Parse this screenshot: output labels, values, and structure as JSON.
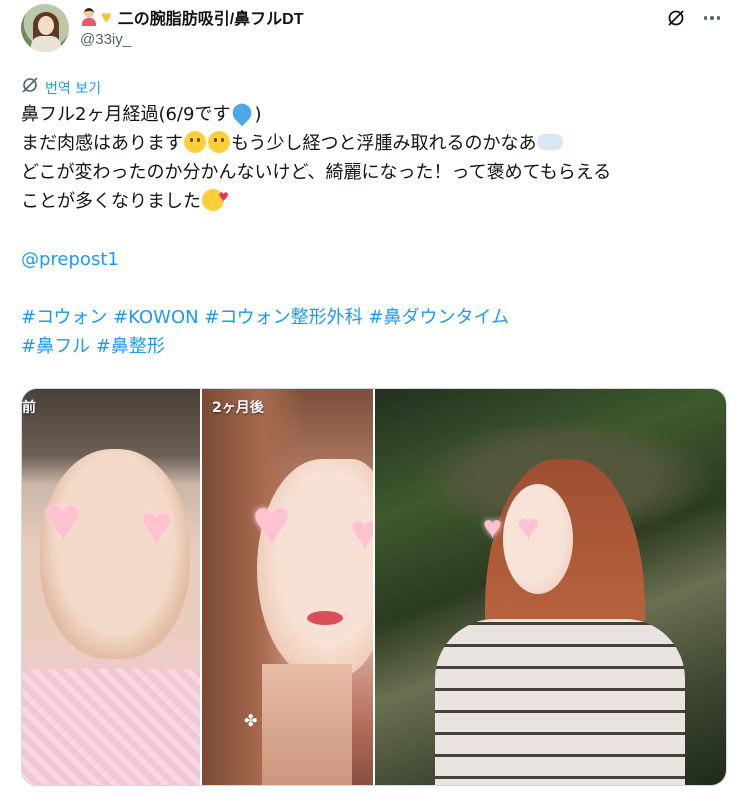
{
  "author": {
    "display_name": "二の腕脂肪吸引/鼻フルDT",
    "handle": "@33iy_",
    "name_emojis": [
      "person-emoji",
      "yellow-heart-emoji"
    ]
  },
  "actions": {
    "grok_icon": "grok-slash-icon",
    "more_icon": "more-dots-icon"
  },
  "translate": {
    "label": "번역 보기",
    "icon": "translate-globe-icon"
  },
  "tweet": {
    "line1": "鼻フル2ヶ月経過(6/9です",
    "line1_end": ")",
    "line2_a": "まだ肉感はあります",
    "line2_b": "もう少し経つと浮腫み取れるのかなあ",
    "line3": "どこが変わったのか分かんないけど、綺麗になった！って褒めてもらえる",
    "line4": "ことが多くなりました",
    "mention": "@prepost1",
    "hashtags_line1": "#コウォン #KOWON #コウォン整形外科 #鼻ダウンタイム",
    "hashtags_line2": "#鼻フル #鼻整形"
  },
  "media": {
    "panel1_label": "前",
    "panel2_label": "2ヶ月後"
  },
  "colors": {
    "accent": "#1d9bf0",
    "text": "#0f1419",
    "muted": "#536471"
  }
}
